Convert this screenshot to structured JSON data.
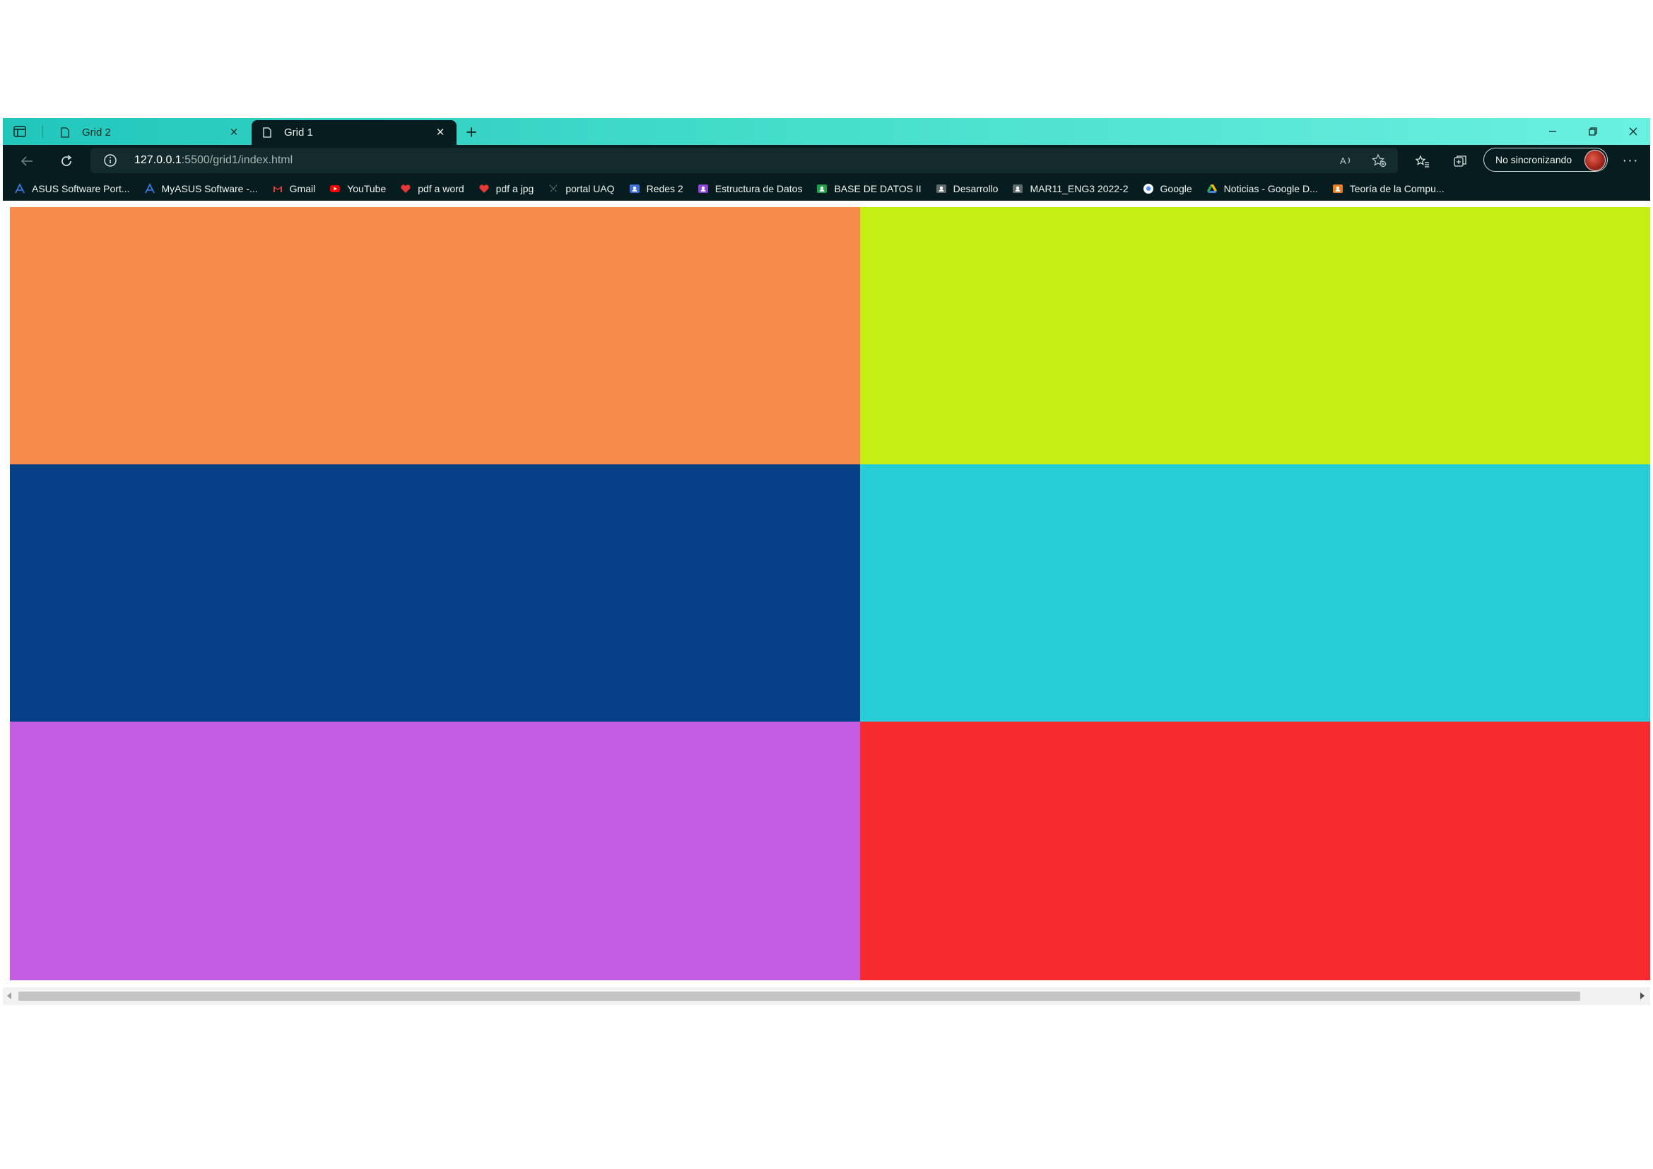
{
  "tabs": [
    {
      "title": "Grid 2",
      "active": false
    },
    {
      "title": "Grid 1",
      "active": true
    }
  ],
  "window": {
    "minimize_icon": "minimize-icon",
    "restore_icon": "restore-icon",
    "close_icon": "close-icon"
  },
  "toolbar": {
    "url_host": "127.0.0.1",
    "url_path": ":5500/grid1/index.html",
    "sync_label": "No sincronizando",
    "more_label": "···"
  },
  "bookmarks": [
    {
      "label": "ASUS Software Port...",
      "icon": "asus-icon",
      "color": "#3b82f6"
    },
    {
      "label": "MyASUS Software -...",
      "icon": "asus-icon",
      "color": "#3b82f6"
    },
    {
      "label": "Gmail",
      "icon": "gmail-icon",
      "color": "#ea4335"
    },
    {
      "label": "YouTube",
      "icon": "youtube-icon",
      "color": "#ff0000"
    },
    {
      "label": "pdf a word",
      "icon": "heart-icon",
      "color": "#e53935"
    },
    {
      "label": "pdf a jpg",
      "icon": "heart-icon",
      "color": "#e53935"
    },
    {
      "label": "portal UAQ",
      "icon": "portal-icon",
      "color": "#7a8c8b"
    },
    {
      "label": "Redes 2",
      "icon": "classroom-icon",
      "color": "#3d6fd8"
    },
    {
      "label": "Estructura de Datos",
      "icon": "classroom-icon",
      "color": "#8e44d9"
    },
    {
      "label": "BASE DE DATOS II",
      "icon": "classroom-icon",
      "color": "#1e9e4a"
    },
    {
      "label": "Desarrollo",
      "icon": "classroom-icon",
      "color": "#5f6b6a"
    },
    {
      "label": "MAR11_ENG3 2022-2",
      "icon": "classroom-icon",
      "color": "#5f6b6a"
    },
    {
      "label": "Google",
      "icon": "google-icon",
      "color": "#ffffff"
    },
    {
      "label": "Noticias - Google D...",
      "icon": "drive-icon",
      "color": "#34a853"
    },
    {
      "label": "Teoría de la Compu...",
      "icon": "classroom-icon",
      "color": "#e67e22"
    }
  ],
  "grid": {
    "cells": [
      {
        "color": "#f78b4b"
      },
      {
        "color": "#c5ef12"
      },
      {
        "color": "#063f86"
      },
      {
        "color": "#27cdd6"
      },
      {
        "color": "#c35de4"
      },
      {
        "color": "#f72b2d"
      }
    ]
  }
}
